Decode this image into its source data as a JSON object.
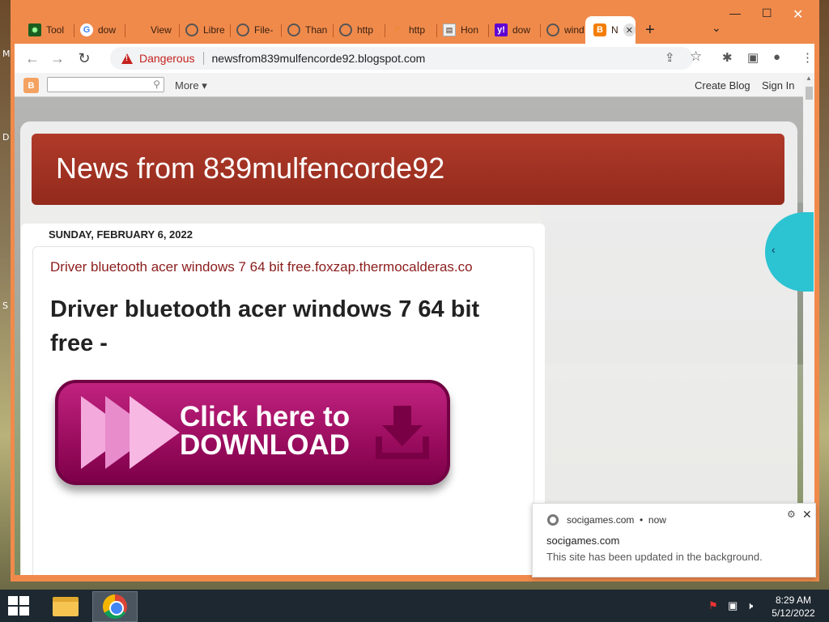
{
  "desktop": {
    "left_letters": [
      "M",
      "D",
      "S"
    ]
  },
  "browser": {
    "tabs": [
      {
        "label": "Tool",
        "icon": "gear-icon"
      },
      {
        "label": "dow",
        "icon": "google-icon"
      },
      {
        "label": "View",
        "icon": "blank-icon"
      },
      {
        "label": "Libre",
        "icon": "globe-icon"
      },
      {
        "label": "File-",
        "icon": "globe-icon"
      },
      {
        "label": "Than",
        "icon": "globe-icon"
      },
      {
        "label": "http",
        "icon": "globe-icon"
      },
      {
        "label": "http",
        "icon": "loading-icon"
      },
      {
        "label": "Hon",
        "icon": "page-icon"
      },
      {
        "label": "dow",
        "icon": "yahoo-icon"
      },
      {
        "label": "wind",
        "icon": "globe-icon"
      },
      {
        "label": "N",
        "icon": "blogger-icon",
        "active": true
      }
    ],
    "new_tab": "+",
    "tab_menu": "⌄",
    "window_controls": {
      "minimize": "—",
      "maximize": "☐",
      "close": "✕"
    },
    "nav": {
      "back": "←",
      "forward": "→",
      "reload": "↻"
    },
    "omnibox": {
      "security_label": "Dangerous",
      "url": "newsfrom839mulfencorde92.blogspot.com"
    },
    "toolbar_icons": {
      "share": "⇪",
      "star": "☆",
      "extensions": "✱",
      "sidepanel": "▣",
      "profile": "●",
      "menu": "⋮"
    }
  },
  "blogger_bar": {
    "more": "More ▾",
    "create_blog": "Create Blog",
    "sign_in": "Sign In"
  },
  "blog": {
    "title": "News from 839mulfencorde92",
    "date": "SUNDAY, FEBRUARY 6, 2022",
    "post_link": "Driver bluetooth acer windows 7 64 bit free.foxzap.thermocalderas.co",
    "post_title": "Driver bluetooth acer windows 7 64 bit free -",
    "download_button": {
      "line1": "Click here to",
      "line2": "DOWNLOAD"
    },
    "side_tab_arrow": "‹"
  },
  "notification": {
    "source": "socigames.com",
    "time": "now",
    "title": "socigames.com",
    "body": "This site has been updated in the background."
  },
  "taskbar": {
    "clock_time": "8:29 AM",
    "clock_date": "5/12/2022"
  }
}
